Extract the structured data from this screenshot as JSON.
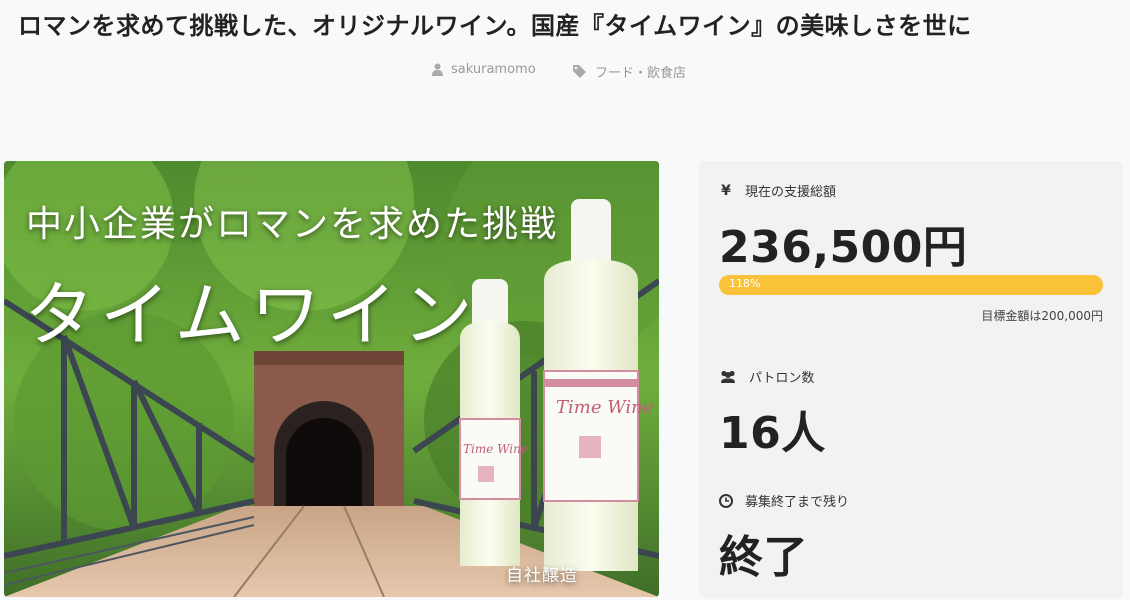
{
  "project": {
    "title": "ロマンを求めて挑戦した、オリジナルワイン。国産『タイムワイン』の美味しさを世に",
    "author": "sakuramomo",
    "author_icon": "user-icon",
    "category": "フード・飲食店",
    "category_icon": "tag-icon"
  },
  "hero": {
    "subtitle": "中小企業がロマンを求めた挑戦",
    "headline": "タイムワイン",
    "tag": "自社醸造",
    "bottle_label": "Time Wine"
  },
  "stats": {
    "funding": {
      "icon": "yen-icon",
      "label": "現在の支援総額",
      "value": "236,500円",
      "progress_text": "118%",
      "progress_fraction": 1.18,
      "goal_text": "目標金額は200,000円"
    },
    "backers": {
      "icon": "users-icon",
      "label": "パトロン数",
      "value": "16人"
    },
    "remaining": {
      "icon": "clock-icon",
      "label": "募集終了まで残り",
      "value": "終了"
    }
  },
  "colors": {
    "progress": "#f9c238",
    "panel_bg": "#f0f2f4",
    "page_bg": "#f7f9fb"
  }
}
